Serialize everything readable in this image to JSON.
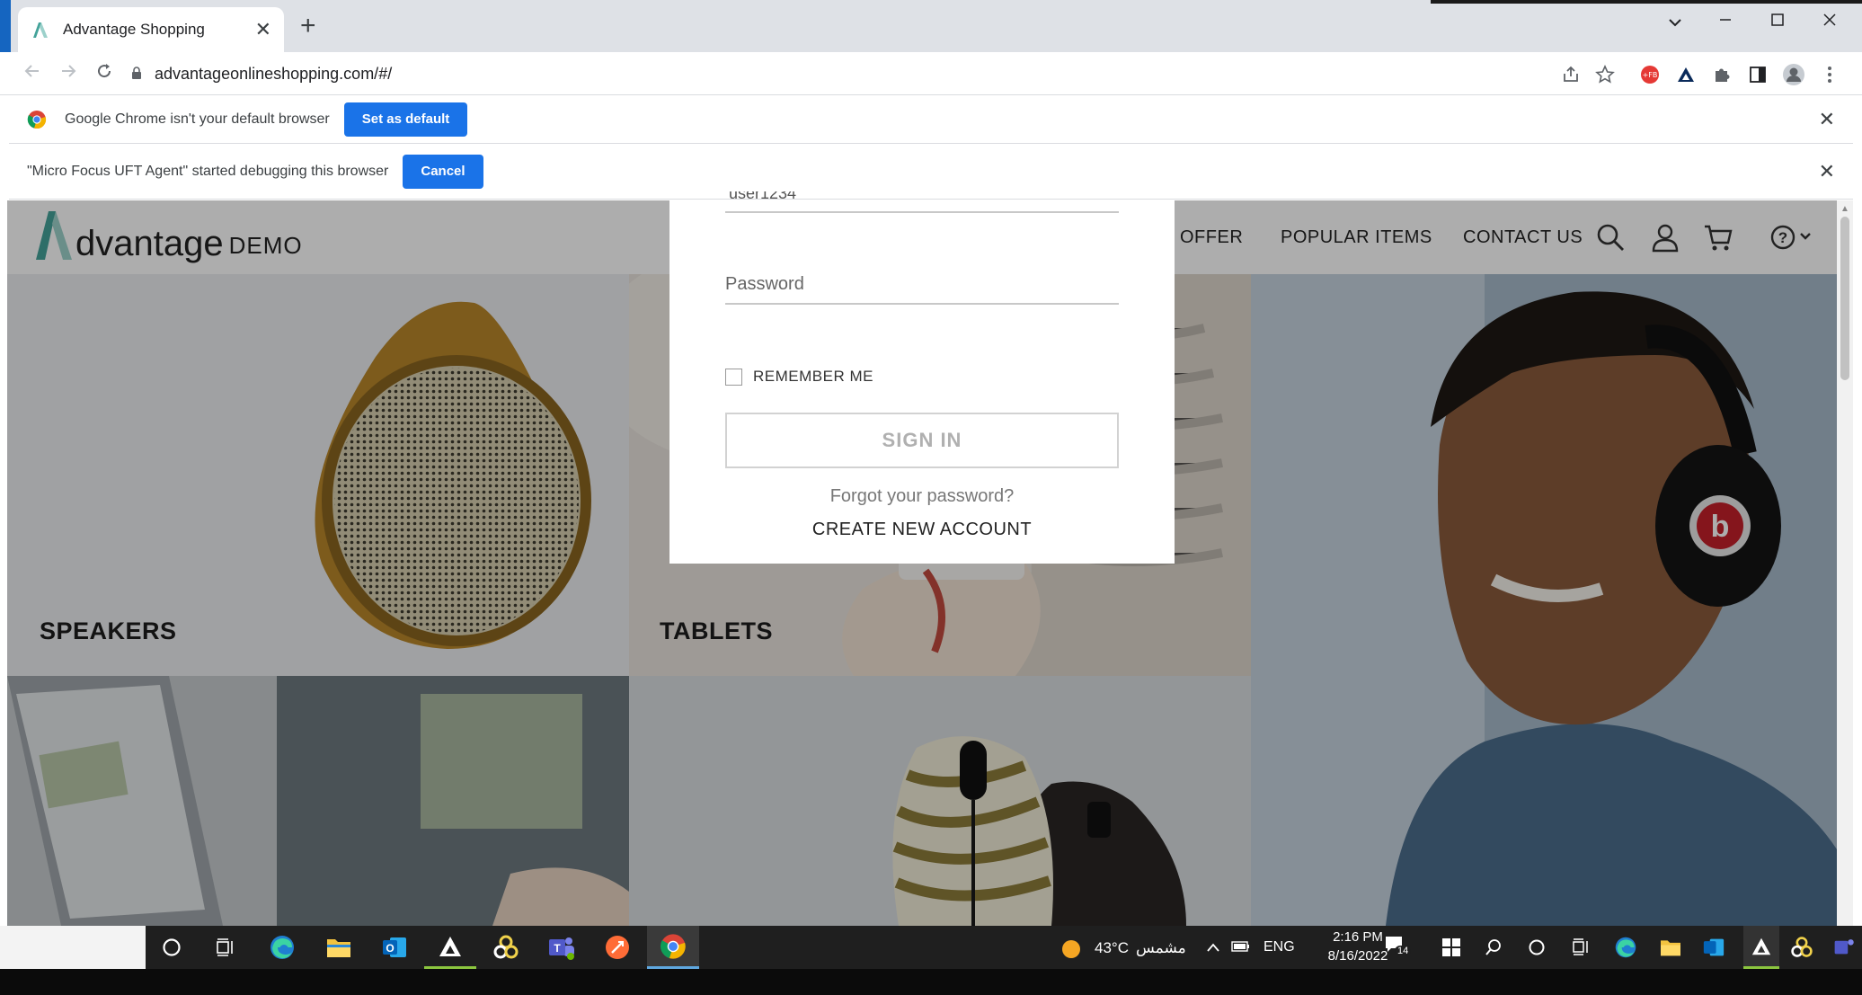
{
  "browser": {
    "tab_title": "Advantage Shopping",
    "url": "advantageonlineshopping.com/#/",
    "new_tab_symbol": "+",
    "tab_close_symbol": "✕"
  },
  "infobars": {
    "default_browser": {
      "message": "Google Chrome isn't your default browser",
      "button": "Set as default"
    },
    "debugging": {
      "message": "\"Micro Focus UFT Agent\" started debugging this browser",
      "button": "Cancel"
    }
  },
  "site": {
    "logo_word": "dvantage",
    "logo_demo": "DEMO",
    "nav": [
      "OFFER",
      "POPULAR ITEMS",
      "CONTACT US"
    ],
    "categories": {
      "speakers": "SPEAKERS",
      "tablets": "TABLETS"
    }
  },
  "login_modal": {
    "username_value": "user1234",
    "password_placeholder": "Password",
    "remember_me": "REMEMBER ME",
    "sign_in": "SIGN IN",
    "forgot": "Forgot your password?",
    "create_account": "CREATE NEW ACCOUNT"
  },
  "taskbar": {
    "weather_temp": "43°C",
    "weather_label": "مشمس",
    "language": "ENG",
    "time": "2:16 PM",
    "date": "8/16/2022",
    "notifications": "14"
  },
  "colors": {
    "accent_blue": "#1a73e8",
    "logo_teal": "#44a39a"
  }
}
